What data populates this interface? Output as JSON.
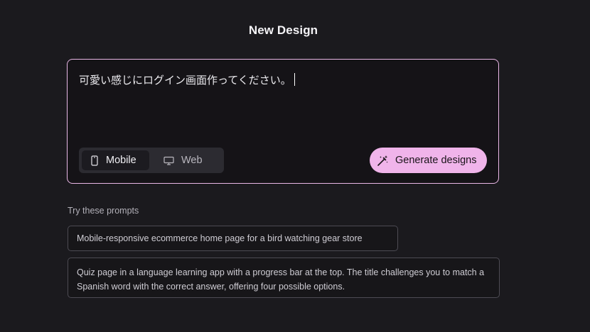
{
  "page": {
    "title": "New Design"
  },
  "prompt": {
    "value": "可愛い感じにログイン画面作ってください。"
  },
  "device_toggle": {
    "options": [
      {
        "label": "Mobile",
        "icon": "mobile-phone-icon",
        "selected": true
      },
      {
        "label": "Web",
        "icon": "desktop-monitor-icon",
        "selected": false
      }
    ]
  },
  "generate_button": {
    "label": "Generate designs",
    "icon": "magic-wand-icon",
    "color": "#f0b4ea"
  },
  "suggestions": {
    "label": "Try these prompts",
    "items": [
      "Mobile-responsive ecommerce home page for a bird watching gear store",
      "Quiz page in a language learning app with a progress bar at the top. The title challenges you to match a Spanish word with the correct answer, offering four possible options."
    ]
  },
  "colors": {
    "background": "#1b1a1e",
    "accent": "#f0b4ea",
    "input_border": "#e9b7e6"
  }
}
